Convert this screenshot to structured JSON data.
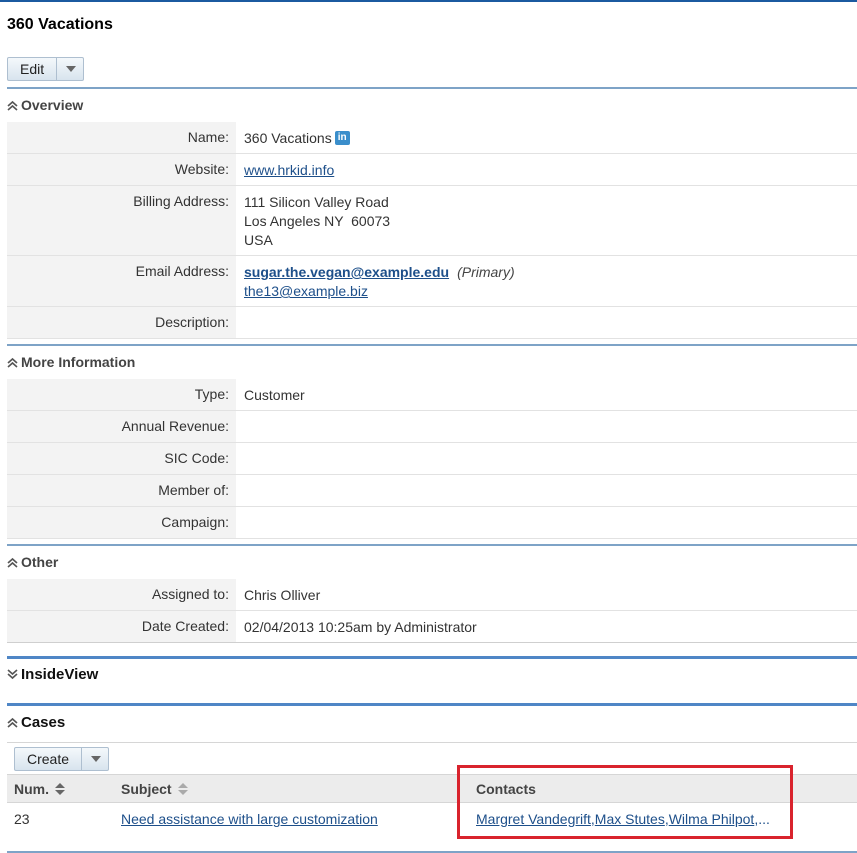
{
  "record": {
    "title": "360 Vacations",
    "edit_label": "Edit"
  },
  "overview": {
    "header": "Overview",
    "fields": {
      "name_label": "Name:",
      "name_value": "360 Vacations",
      "linkedin_text": "in",
      "website_label": "Website:",
      "website_value": "www.hrkid.info",
      "billing_label": "Billing Address:",
      "billing_line1": "111 Silicon Valley Road",
      "billing_line2": "Los Angeles NY  60073",
      "billing_line3": "USA",
      "email_label": "Email Address:",
      "email_primary": "sugar.the.vegan@example.edu",
      "email_primary_tag": "(Primary)",
      "email_secondary": "the13@example.biz",
      "description_label": "Description:"
    }
  },
  "more_info": {
    "header": "More Information",
    "type_label": "Type:",
    "type_value": "Customer",
    "revenue_label": "Annual Revenue:",
    "sic_label": "SIC Code:",
    "member_label": "Member of:",
    "campaign_label": "Campaign:"
  },
  "other": {
    "header": "Other",
    "assigned_label": "Assigned to:",
    "assigned_value": "Chris Olliver",
    "created_label": "Date Created:",
    "created_value": "02/04/2013 10:25am by Administrator"
  },
  "insideview": {
    "header": "InsideView"
  },
  "cases": {
    "header": "Cases",
    "create_label": "Create",
    "columns": {
      "num": "Num.",
      "subject": "Subject",
      "contacts": "Contacts"
    },
    "rows": [
      {
        "num": "23",
        "subject": "Need assistance with large customization",
        "contact1": "Margret Vandegrift",
        "contact2": "Max Stutes",
        "contact3": "Wilma Philpot",
        "ellipsis": ",..."
      }
    ]
  },
  "colors": {
    "accent": "#4f86c6",
    "link": "#1d4f8a",
    "highlight": "#d9232d"
  }
}
